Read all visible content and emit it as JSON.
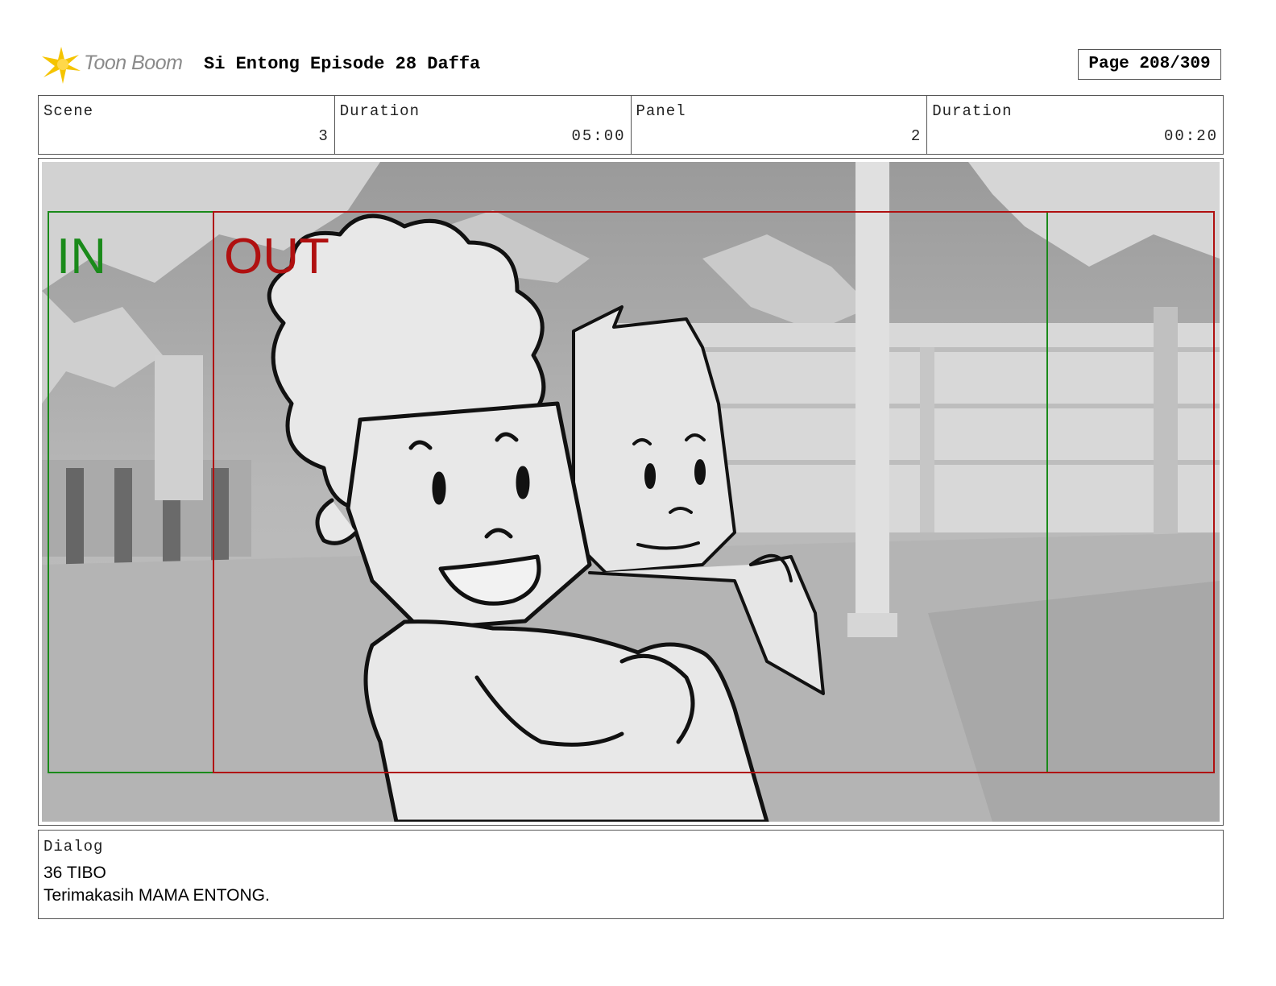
{
  "header": {
    "logo_text": "Toon Boom",
    "title": "Si Entong Episode 28 Daffa",
    "page": "Page 208/309"
  },
  "info": {
    "scene_label": "Scene",
    "scene_value": "3",
    "scene_duration_label": "Duration",
    "scene_duration_value": "05:00",
    "panel_label": "Panel",
    "panel_value": "2",
    "panel_duration_label": "Duration",
    "panel_duration_value": "00:20"
  },
  "panel": {
    "in_label": "IN",
    "out_label": "OUT",
    "in_color": "#1a8a1a",
    "out_color": "#b01010"
  },
  "dialog": {
    "label": "Dialog",
    "line1": "36 TIBO",
    "line2": "Terimakasih MAMA ENTONG."
  },
  "colors": {
    "logo_yellow": "#f5c400",
    "frame_border": "#555555"
  }
}
